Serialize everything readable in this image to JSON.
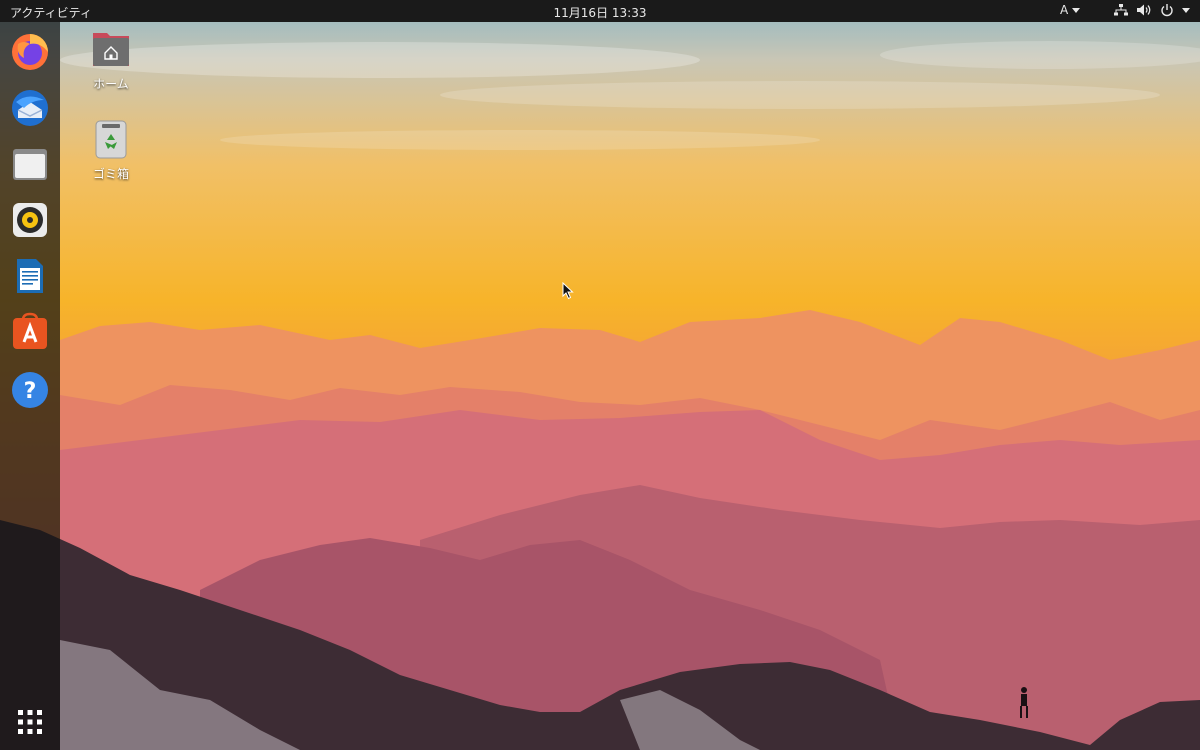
{
  "topbar": {
    "activities_label": "アクティビティ",
    "clock": "11月16日 13:33",
    "input_source": "A"
  },
  "desktop": {
    "icons": [
      {
        "label": "ホーム"
      },
      {
        "label": "ゴミ箱"
      }
    ]
  },
  "dock": {
    "apps": [
      "firefox-icon",
      "thunderbird-icon",
      "files-icon",
      "rhythmbox-icon",
      "libreoffice-writer-icon",
      "ubuntu-software-icon",
      "help-icon"
    ],
    "show_apps": "show-applications-icon"
  },
  "colors": {
    "topbar": "#1a1a1a",
    "sky_top": "#9fc4cf",
    "sky_mid": "#f3b233",
    "mountain_far": "#e98a62",
    "mountain_near": "#3a2a30"
  }
}
